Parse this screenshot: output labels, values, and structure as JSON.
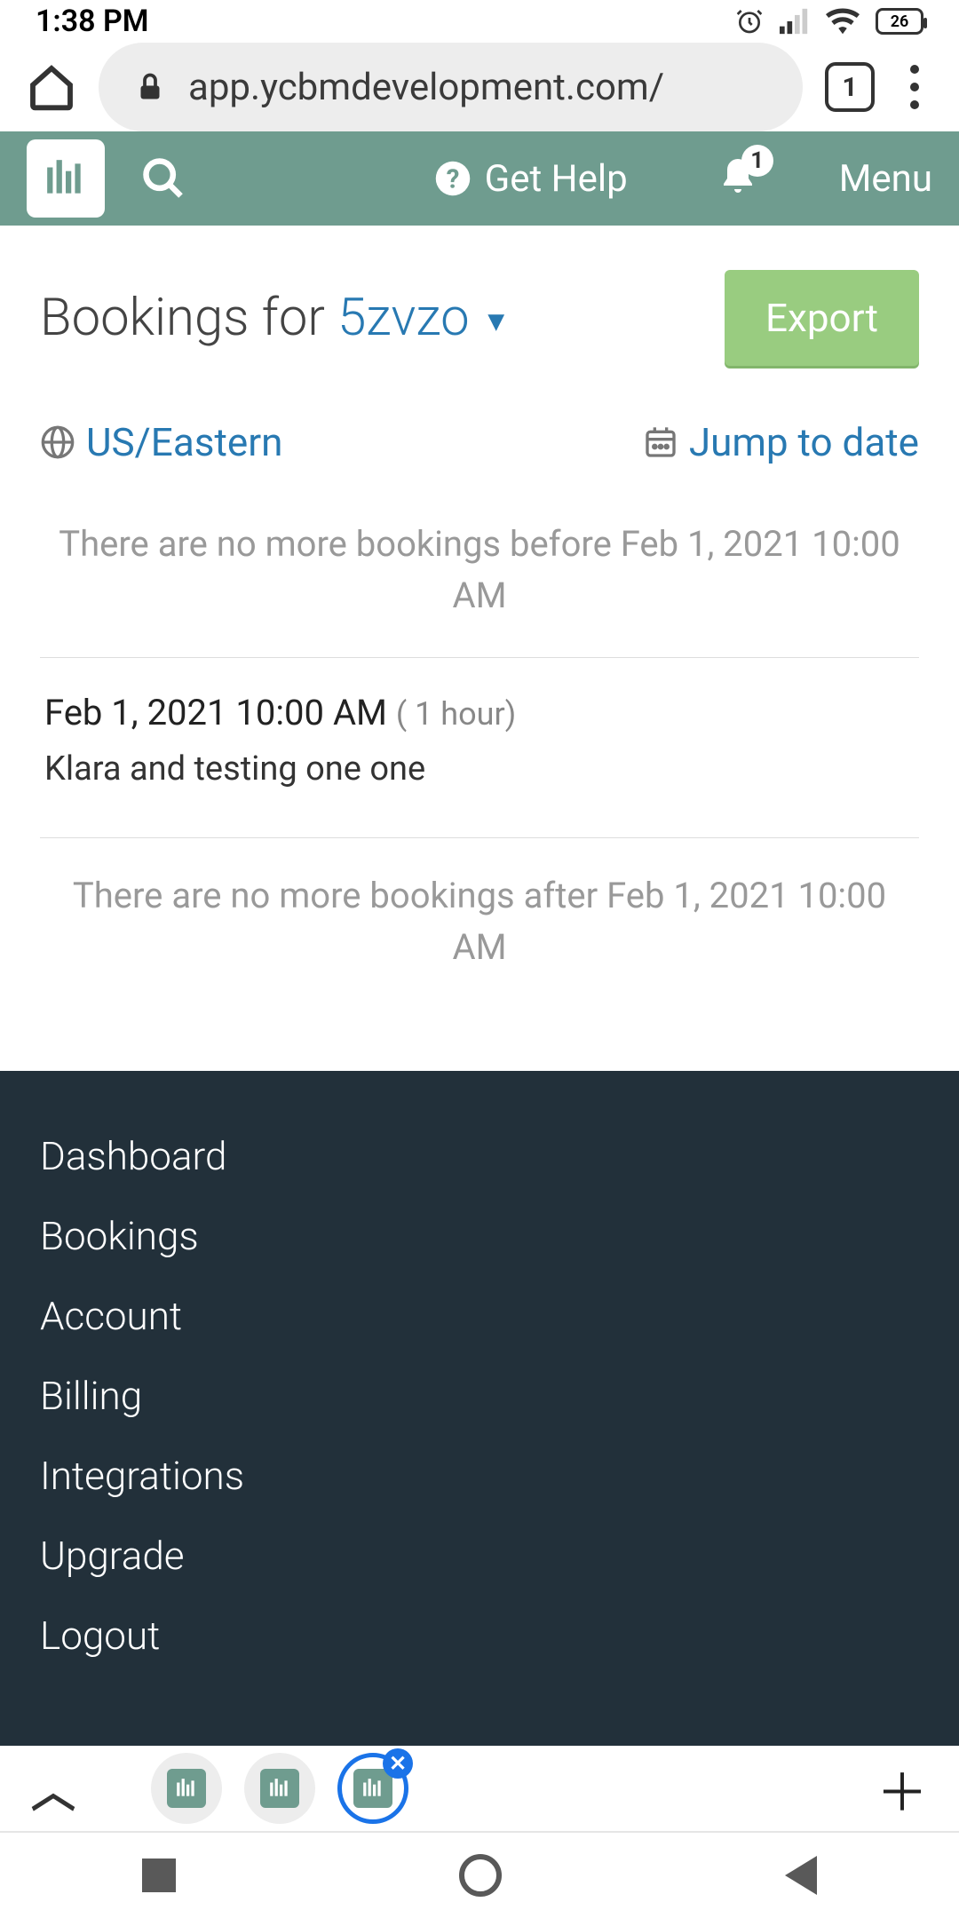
{
  "status": {
    "time": "1:38 PM",
    "battery": "26"
  },
  "browser": {
    "url": "app.ycbmdevelopment.com/",
    "tab_count": "1"
  },
  "header": {
    "help": "Get Help",
    "menu": "Menu",
    "notification_count": "1"
  },
  "page": {
    "title_prefix": "Bookings for ",
    "calendar_name": "5zvzo",
    "export": "Export",
    "timezone": "US/Eastern",
    "jump": "Jump to date",
    "empty_before": "There are no more bookings before Feb 1, 2021 10:00 AM",
    "empty_after": "There are no more bookings after Feb 1, 2021 10:00 AM"
  },
  "booking": {
    "datetime": "Feb 1, 2021 10:00 AM",
    "duration": "( 1 hour)",
    "description": "Klara and testing one one"
  },
  "footer": {
    "items": [
      "Dashboard",
      "Bookings",
      "Account",
      "Billing",
      "Integrations",
      "Upgrade",
      "Logout"
    ]
  }
}
